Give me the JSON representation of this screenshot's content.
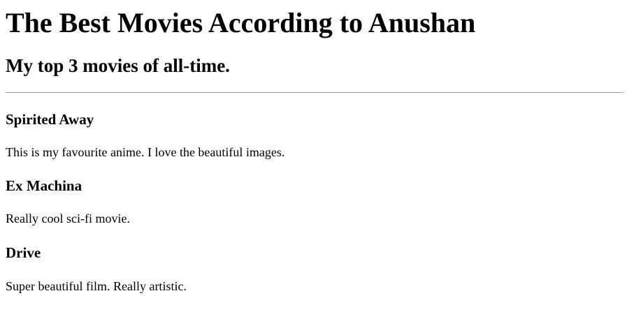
{
  "title": "The Best Movies According to Anushan",
  "subtitle": "My top 3 movies of all-time.",
  "movies": [
    {
      "name": "Spirited Away",
      "description": "This is my favourite anime. I love the beautiful images."
    },
    {
      "name": "Ex Machina",
      "description": "Really cool sci-fi movie."
    },
    {
      "name": "Drive",
      "description": "Super beautiful film. Really artistic."
    }
  ]
}
